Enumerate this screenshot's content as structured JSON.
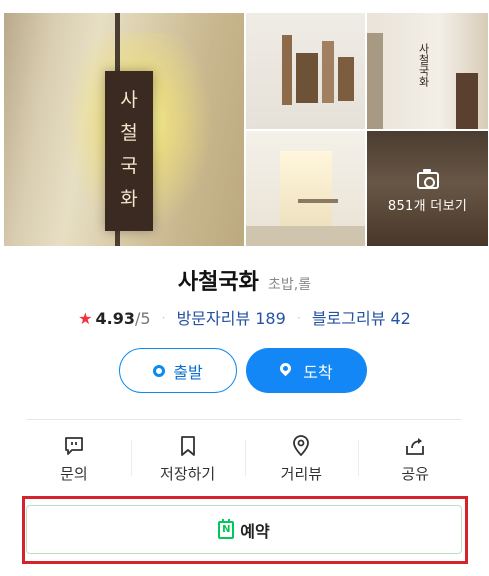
{
  "place": {
    "name": "사철국화",
    "category": "초밥,롤"
  },
  "gallery": {
    "sign_text": [
      "사",
      "철",
      "국",
      "화"
    ],
    "wall_text": "사철국화",
    "more_label": "851개 더보기"
  },
  "rating": {
    "score": "4.93",
    "max": "/5",
    "visitor_reviews": "방문자리뷰 189",
    "blog_reviews": "블로그리뷰 42"
  },
  "route": {
    "depart_label": "출발",
    "arrive_label": "도착"
  },
  "actions": [
    {
      "label": "문의",
      "icon": "chat-icon"
    },
    {
      "label": "저장하기",
      "icon": "bookmark-icon"
    },
    {
      "label": "거리뷰",
      "icon": "location-pin-icon"
    },
    {
      "label": "공유",
      "icon": "share-icon"
    }
  ],
  "reserve": {
    "label": "예약",
    "icon_text": "N"
  },
  "colors": {
    "accent_blue": "#1287f5",
    "link_blue": "#2553a3",
    "star_red": "#f2343a",
    "naver_green": "#03c75a",
    "highlight_red": "#d4232a"
  }
}
